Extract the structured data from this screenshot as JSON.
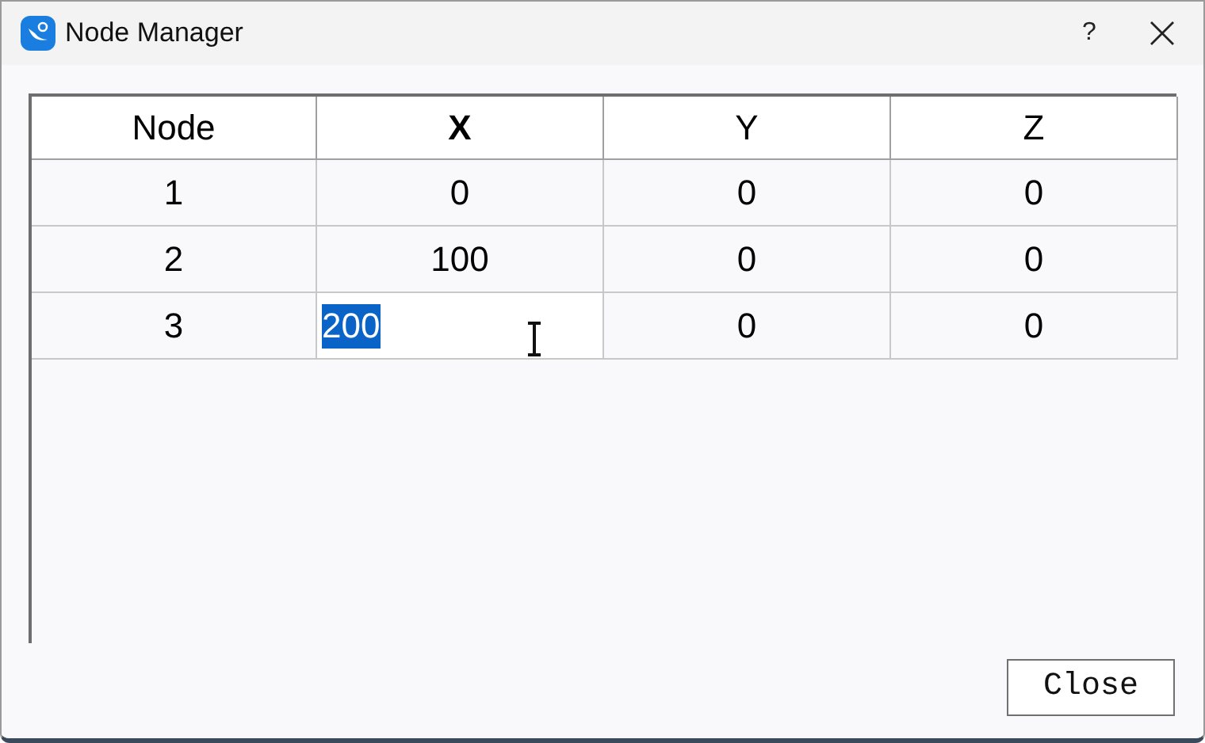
{
  "window": {
    "title": "Node Manager",
    "help": "?"
  },
  "table": {
    "columns": [
      {
        "label": "Node",
        "selected": false
      },
      {
        "label": "X",
        "selected": true
      },
      {
        "label": "Y",
        "selected": false
      },
      {
        "label": "Z",
        "selected": false
      }
    ],
    "rows": [
      {
        "cells": [
          {
            "text": "1",
            "editing": false
          },
          {
            "text": "0",
            "editing": false
          },
          {
            "text": "0",
            "editing": false
          },
          {
            "text": "0",
            "editing": false
          }
        ]
      },
      {
        "cells": [
          {
            "text": "2",
            "editing": false
          },
          {
            "text": "100",
            "editing": false
          },
          {
            "text": "0",
            "editing": false
          },
          {
            "text": "0",
            "editing": false
          }
        ]
      },
      {
        "cells": [
          {
            "text": "3",
            "editing": false
          },
          {
            "text": "200",
            "editing": true
          },
          {
            "text": "0",
            "editing": false
          },
          {
            "text": "0",
            "editing": false
          }
        ]
      }
    ]
  },
  "buttons": [
    {
      "label": "Close"
    }
  ]
}
